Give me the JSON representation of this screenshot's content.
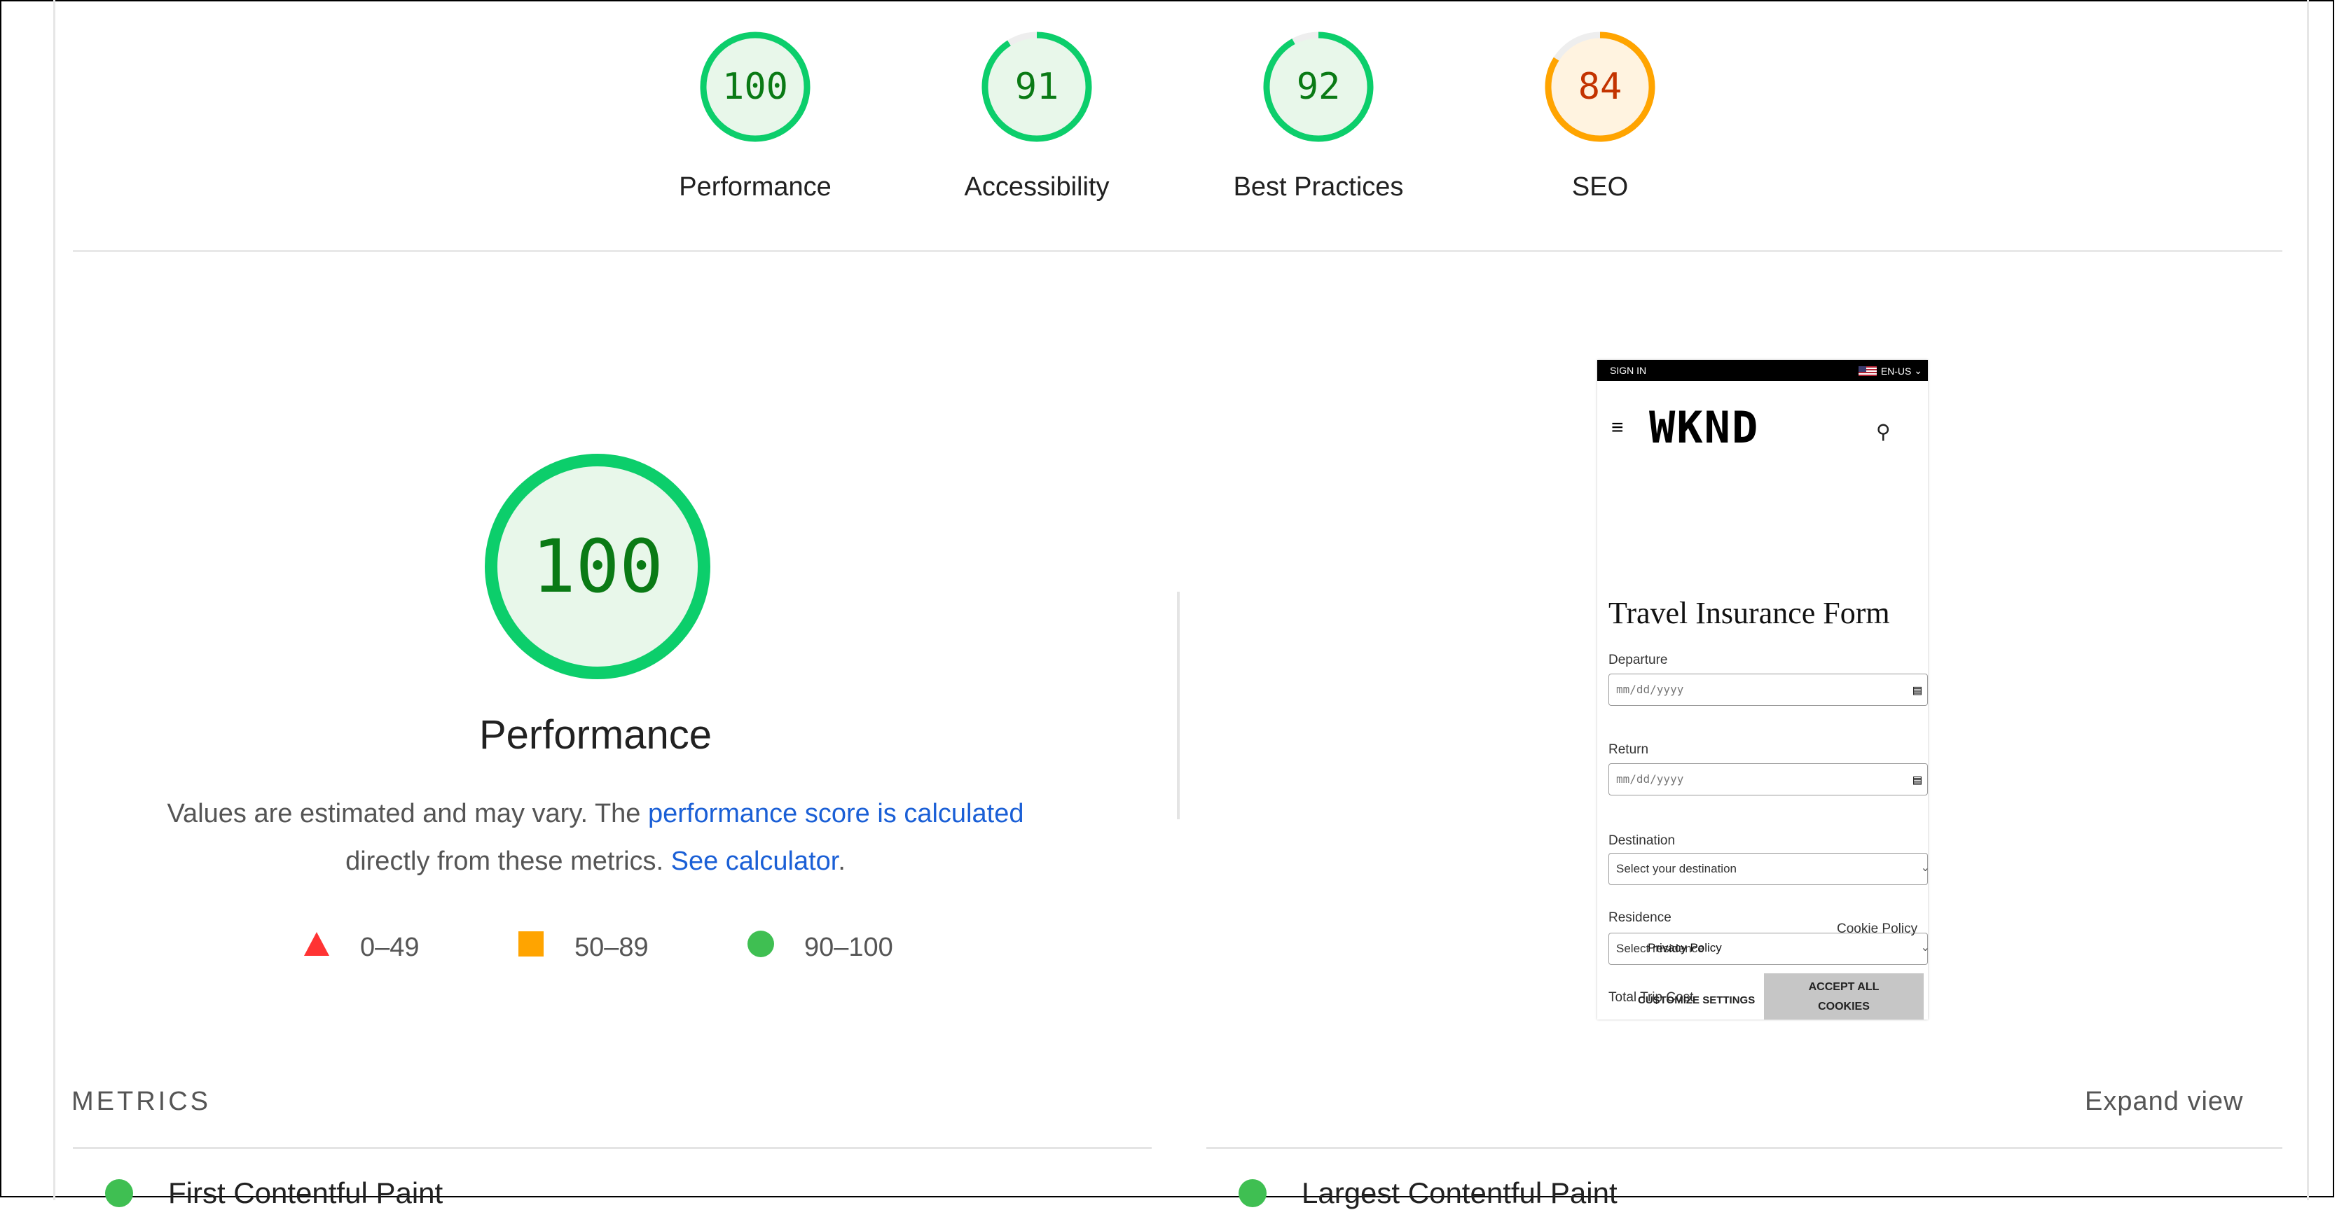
{
  "categories": [
    {
      "score": "100",
      "label": "Performance",
      "color": "#0cce6b",
      "text_color": "#0a7a15",
      "fill": "#e8f7ea",
      "fraction": 1.0
    },
    {
      "score": "91",
      "label": "Accessibility",
      "color": "#0cce6b",
      "text_color": "#0a7a15",
      "fill": "#e8f7ea",
      "fraction": 0.91
    },
    {
      "score": "92",
      "label": "Best Practices",
      "color": "#0cce6b",
      "text_color": "#0a7a15",
      "fill": "#e8f7ea",
      "fraction": 0.92
    },
    {
      "score": "84",
      "label": "SEO",
      "color": "#ffa400",
      "text_color": "#c33300",
      "fill": "#fff3e0",
      "fraction": 0.84
    }
  ],
  "performance": {
    "score": "100",
    "title": "Performance",
    "desc_text_1": "Values are estimated and may vary. The ",
    "desc_link_1": "performance score is calculated",
    "desc_text_2": "directly from these metrics. ",
    "desc_link_2": "See calculator",
    "desc_text_3": "."
  },
  "legend": [
    {
      "range": "0–49",
      "shape": "triangle",
      "color": "#ff3333"
    },
    {
      "range": "50–89",
      "shape": "square",
      "color": "#ffa400"
    },
    {
      "range": "90–100",
      "shape": "circle",
      "color": "#0cce6b"
    }
  ],
  "screenshot": {
    "top_left": "SIGN IN",
    "lang": "EN-US",
    "logo": "WKND",
    "heading": "Travel Insurance Form",
    "fields": [
      {
        "label": "Departure",
        "value": "mm/dd/yyyy"
      },
      {
        "label": "Return",
        "value": "mm/dd/yyyy"
      },
      {
        "label": "Destination",
        "value": "Select your destination"
      },
      {
        "label": "Residence",
        "value": "Select residence"
      }
    ],
    "cookie_policy": "Cookie Policy",
    "privacy_policy": "Privacy Policy",
    "total_label": "Total Trip Cost",
    "customize_settings": "CUSTOMIZE SETTINGS",
    "accept_line_1": "ACCEPT ALL",
    "accept_line_2": "COOKIES"
  },
  "metrics": {
    "title": "METRICS",
    "expand_label": "Expand view",
    "items": [
      {
        "name": "First Contentful Paint"
      },
      {
        "name": "Largest Contentful Paint"
      }
    ]
  }
}
